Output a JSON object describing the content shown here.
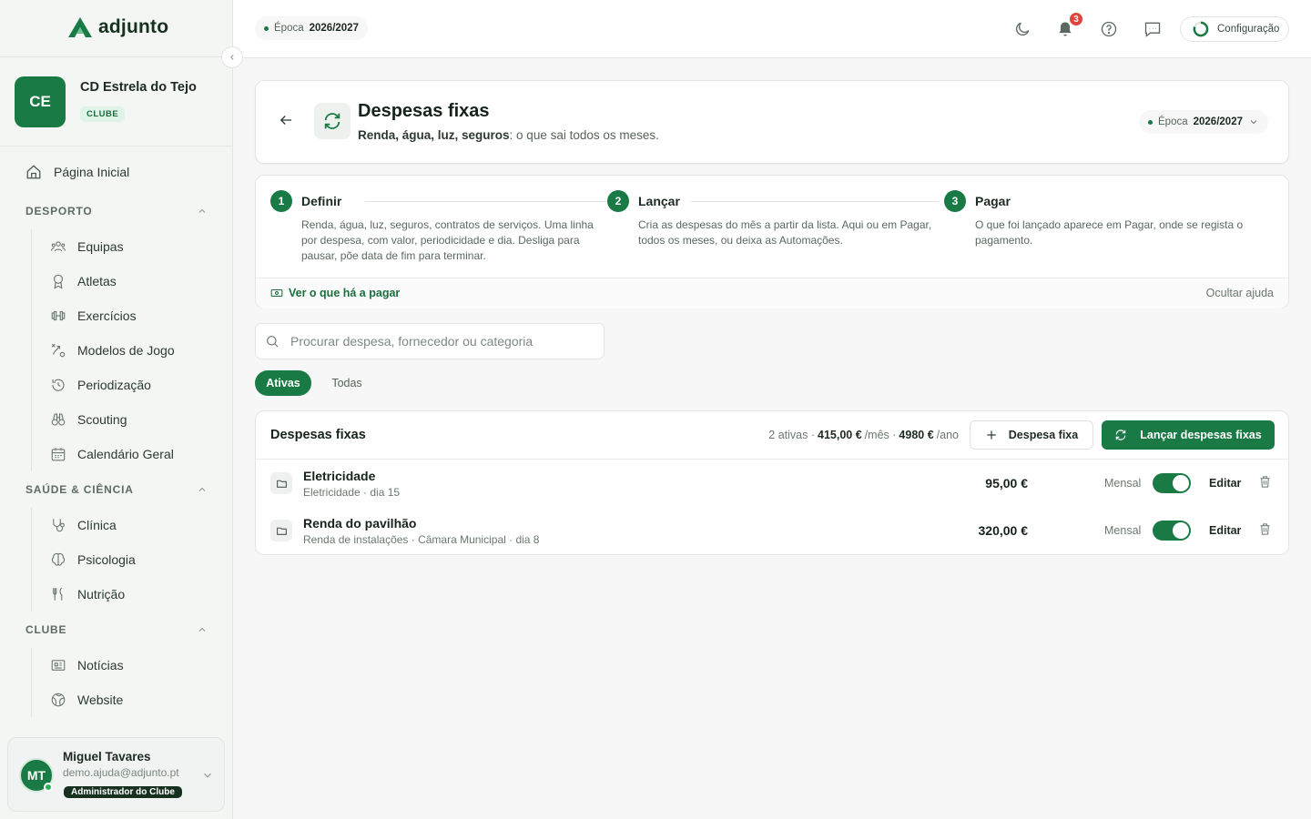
{
  "app": {
    "name": "adjunto"
  },
  "club": {
    "initials": "CE",
    "name": "CD Estrela do Tejo",
    "badge": "CLUBE"
  },
  "nav": {
    "home": "Página Inicial",
    "sections": [
      {
        "title": "DESPORTO",
        "items": [
          "Equipas",
          "Atletas",
          "Exercícios",
          "Modelos de Jogo",
          "Periodização",
          "Scouting",
          "Calendário Geral"
        ]
      },
      {
        "title": "SAÚDE & CIÊNCIA",
        "items": [
          "Clínica",
          "Psicologia",
          "Nutrição"
        ]
      },
      {
        "title": "CLUBE",
        "items": [
          "Notícias",
          "Website"
        ]
      }
    ]
  },
  "user": {
    "initials": "MT",
    "name": "Miguel Tavares",
    "email": "demo.ajuda@adjunto.pt",
    "role": "Administrador do Clube"
  },
  "topbar": {
    "season_label": "Época",
    "season_value": "2026/2027",
    "notifications": "3",
    "config_label": "Configuração"
  },
  "header": {
    "title": "Despesas fixas",
    "subtitle_bold": "Renda, água, luz, seguros",
    "subtitle_rest": ": o que sai todos os meses.",
    "season_label": "Época",
    "season_value": "2026/2027"
  },
  "steps": [
    {
      "num": "1",
      "title": "Definir",
      "desc": "Renda, água, luz, seguros, contratos de serviços. Uma linha por despesa, com valor, periodicidade e dia. Desliga para pausar, põe data de fim para terminar."
    },
    {
      "num": "2",
      "title": "Lançar",
      "desc": "Cria as despesas do mês a partir da lista. Aqui ou em Pagar, todos os meses, ou deixa as Automações."
    },
    {
      "num": "3",
      "title": "Pagar",
      "desc": "O que foi lançado aparece em Pagar, onde se regista o pagamento."
    }
  ],
  "help_footer": {
    "link": "Ver o que há a pagar",
    "hide": "Ocultar ajuda"
  },
  "search": {
    "placeholder": "Procurar despesa, fornecedor ou categoria"
  },
  "filters": {
    "active": "Ativas",
    "all": "Todas"
  },
  "list": {
    "title": "Despesas fixas",
    "stats_count": "2 ativas ·",
    "stats_month": "415,00 €",
    "stats_month_unit": "/mês ·",
    "stats_year": "4980 €",
    "stats_year_unit": "/ano",
    "add_button": "Despesa fixa",
    "launch_button": "Lançar despesas fixas",
    "edit_label": "Editar",
    "rows": [
      {
        "name": "Eletricidade",
        "sub": "Eletricidade · dia 15",
        "amount": "95,00 €",
        "period": "Mensal",
        "active": true
      },
      {
        "name": "Renda do pavilhão",
        "sub": "Renda de instalações · Câmara Municipal · dia 8",
        "amount": "320,00 €",
        "period": "Mensal",
        "active": true
      }
    ]
  },
  "colors": {
    "brand": "#1a7a45",
    "brand_dark": "#16311f",
    "badge_red": "#e0443e"
  }
}
